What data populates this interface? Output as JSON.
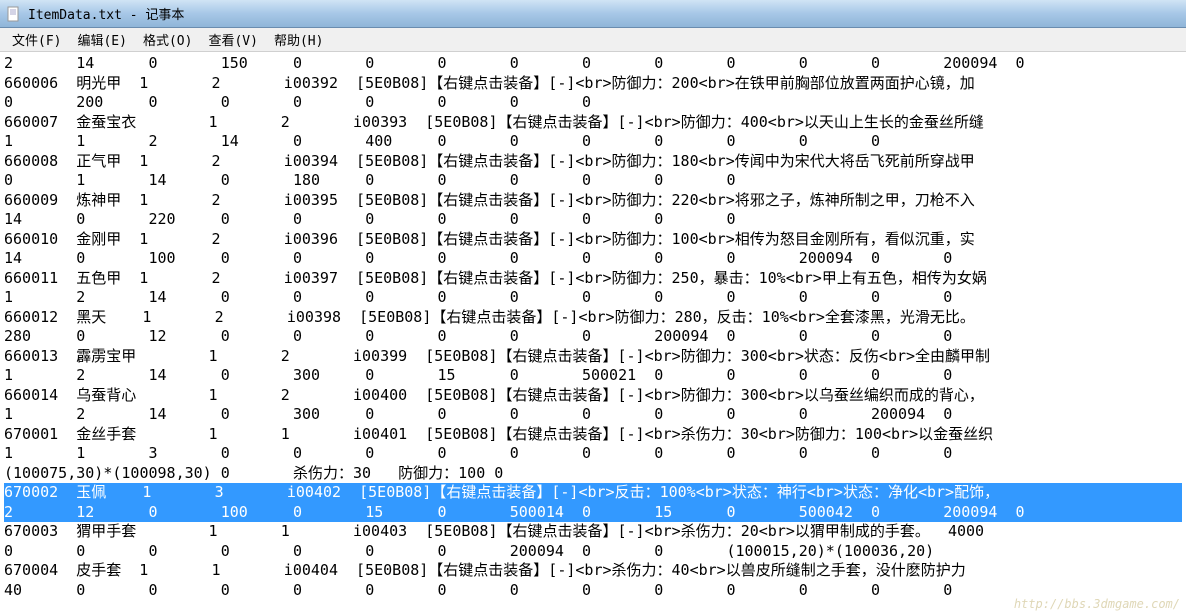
{
  "title": "ItemData.txt - 记事本",
  "menu": {
    "file": "文件(F)",
    "edit": "编辑(E)",
    "format": "格式(O)",
    "view": "查看(V)",
    "help": "帮助(H)"
  },
  "lines": [
    "2       14      0       150     0       0       0       0       0       0       0       0       0       200094  0",
    "660006  明光甲  1       2       i00392  [5E0B08]【右键点击装备】[-]<br>防御力：200<br>在铁甲前胸部位放置两面护心镜，加",
    "0       200     0       0       0       0       0       0       0",
    "660007  金蚕宝衣        1       2       i00393  [5E0B08]【右键点击装备】[-]<br>防御力：400<br>以天山上生长的金蚕丝所缝",
    "1       1       2       14      0       400     0       0       0       0       0       0       0",
    "660008  正气甲  1       2       i00394  [5E0B08]【右键点击装备】[-]<br>防御力：180<br>传闻中为宋代大将岳飞死前所穿战甲",
    "0       1       14      0       180     0       0       0       0       0       0",
    "660009  炼神甲  1       2       i00395  [5E0B08]【右键点击装备】[-]<br>防御力：220<br>将邪之子，炼神所制之甲，刀枪不入",
    "14      0       220     0       0       0       0       0       0       0       0",
    "660010  金刚甲  1       2       i00396  [5E0B08]【右键点击装备】[-]<br>防御力：100<br>相传为怒目金刚所有，看似沉重，实",
    "14      0       100     0       0       0       0       0       0       0       0       200094  0       0",
    "660011  五色甲  1       2       i00397  [5E0B08]【右键点击装备】[-]<br>防御力：250，暴击：10%<br>甲上有五色，相传为女娲",
    "1       2       14      0       0       0       0       0       0       0       0       0       0       0",
    "660012  黑天    1       2       i00398  [5E0B08]【右键点击装备】[-]<br>防御力：280，反击：10%<br>全套漆黑，光滑无比。",
    "280     0       12      0       0       0       0       0       0       200094  0       0       0       0",
    "660013  霹雳宝甲        1       2       i00399  [5E0B08]【右键点击装备】[-]<br>防御力：300<br>状态：反伤<br>全由麟甲制",
    "1       2       14      0       300     0       15      0       500021  0       0       0       0       0",
    "660014  乌蚕背心        1       2       i00400  [5E0B08]【右键点击装备】[-]<br>防御力：300<br>以乌蚕丝编织而成的背心，",
    "1       2       14      0       300     0       0       0       0       0       0       0       200094  0",
    "670001  金丝手套        1       1       i00401  [5E0B08]【右键点击装备】[-]<br>杀伤力：30<br>防御力：100<br>以金蚕丝织",
    "1       1       3       0       0       0       0       0       0       0       0       0       0       0",
    "(100075,30)*(100098,30) 0       杀伤力：30   防御力：100 0"
  ],
  "selected_lines": [
    "670002  玉佩    1       3       i00402  [5E0B08]【右键点击装备】[-]<br>反击：100%<br>状态：神行<br>状态：净化<br>配饰，",
    "2       12      0       100     0       15      0       500014  0       15      0       500042  0       200094  0"
  ],
  "lines_after": [
    "670003  猬甲手套        1       1       i00403  [5E0B08]【右键点击装备】[-]<br>杀伤力：20<br>以猬甲制成的手套。  4000",
    "0       0       0       0       0       0       0       200094  0       0       (100015,20)*(100036,20)",
    "670004  皮手套  1       1       i00404  [5E0B08]【右键点击装备】[-]<br>杀伤力：40<br>以兽皮所缝制之手套，没什麽防护力",
    "40      0       0       0       0       0       0       0       0       0       0       0       0       0"
  ],
  "watermark": "http://bbs.3dmgame.com/"
}
